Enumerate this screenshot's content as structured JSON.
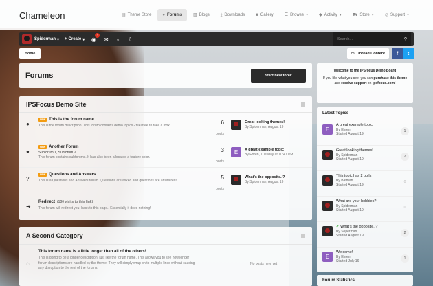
{
  "brand": "Chameleon",
  "topnav": [
    {
      "label": "Theme Store",
      "icon": "page-icon"
    },
    {
      "label": "Forums",
      "icon": "chat-icon",
      "active": true
    },
    {
      "label": "Blogs",
      "icon": "blog-icon"
    },
    {
      "label": "Downloads",
      "icon": "download-icon"
    },
    {
      "label": "Gallery",
      "icon": "camera-icon"
    },
    {
      "label": "Browse",
      "icon": "browse-icon"
    },
    {
      "label": "Activity",
      "icon": "activity-icon"
    },
    {
      "label": "Store",
      "icon": "cart-icon"
    },
    {
      "label": "Support",
      "icon": "support-icon"
    }
  ],
  "userbar": {
    "username": "Spiderman",
    "create": "Create",
    "notif_count": "2",
    "search_placeholder": "Search..."
  },
  "breadcrumb": {
    "home": "Home",
    "unread": "Unread Content",
    "fb": "f",
    "tw": "t"
  },
  "page": {
    "title": "Forums",
    "new_topic": "Start new topic"
  },
  "categories": [
    {
      "title": "IPSFocus Demo Site",
      "forums": [
        {
          "new": "NEW",
          "title": "This is the forum name",
          "desc": "This is the forum description. This forum contains demo topics - feel free to take a look!",
          "count": "6",
          "count_label": "posts",
          "last_title": "Great looking themes!",
          "last_by": "By Spiderman, August 19",
          "avatar": "sp"
        },
        {
          "new": "NEW",
          "title": "Another Forum",
          "subs": "Subforum 1,   Subforum 2",
          "desc": "This forum contains subforums. It has also been allocated a feature color.",
          "count": "3",
          "count_label": "posts",
          "last_title": "A great example topic",
          "last_by": "By Ehren, Tuesday at 10:47 PM",
          "avatar": "e",
          "avatar_letter": "E"
        },
        {
          "new": "NEW",
          "title": "Questions and Answers",
          "desc": "This is a Questions and Answers forum. Questions are asked and questions are answered!",
          "count": "5",
          "count_label": "posts",
          "last_title": "What's the opposite..?",
          "last_by": "By Spiderman, August 19",
          "avatar": "sp"
        },
        {
          "title": "Redirect",
          "redirect_note": "(130 visits to this link)",
          "desc": "This forum will redirect you, back to this page.. Essentially it does nothing!"
        }
      ]
    },
    {
      "title": "A Second Category",
      "forums": [
        {
          "title": "This forum name is a little longer than all of the others!",
          "desc": "This is going to be a longer description, just like the forum name. This allows you to see how longer forum descriptions are handled by the theme. They will simply wrap on to multiple lines without causing any disruption to the rest of the forums.",
          "no_posts": "No posts here yet"
        }
      ]
    }
  ],
  "welcome": {
    "title": "Welcome to the IPSfocus Demo Board",
    "line1": "If you like what you see, you can",
    "link1": "purchase this theme",
    "mid": "and",
    "link2": "receive support",
    "on": "on",
    "link3": "ipsfocus.com",
    "end": "!"
  },
  "latest": {
    "title": "Latest Topics",
    "items": [
      {
        "title": "A great example topic",
        "by": "By Ehren",
        "started": "Started August 19",
        "count": "1",
        "avatar": "e",
        "letter": "E"
      },
      {
        "title": "Great looking themes!",
        "by": "By Spiderman",
        "started": "Started August 19",
        "count": "2",
        "avatar": "sp"
      },
      {
        "title": "This topic has 2 polls",
        "by": "By Batman",
        "started": "Started August 19",
        "count": "0",
        "avatar": "sp"
      },
      {
        "title": "What are your hobbies?",
        "by": "By Spiderman",
        "started": "Started August 19",
        "count": "0",
        "avatar": "sp"
      },
      {
        "title": "What's the opposite..?",
        "by": "By Superman",
        "started": "Started August 19",
        "count": "2",
        "avatar": "sp"
      },
      {
        "title": "Welcome!",
        "by": "By Ehren",
        "started": "Started July 16",
        "count": "1",
        "avatar": "e",
        "letter": "E"
      }
    ]
  },
  "stats_title": "Forum Statistics"
}
